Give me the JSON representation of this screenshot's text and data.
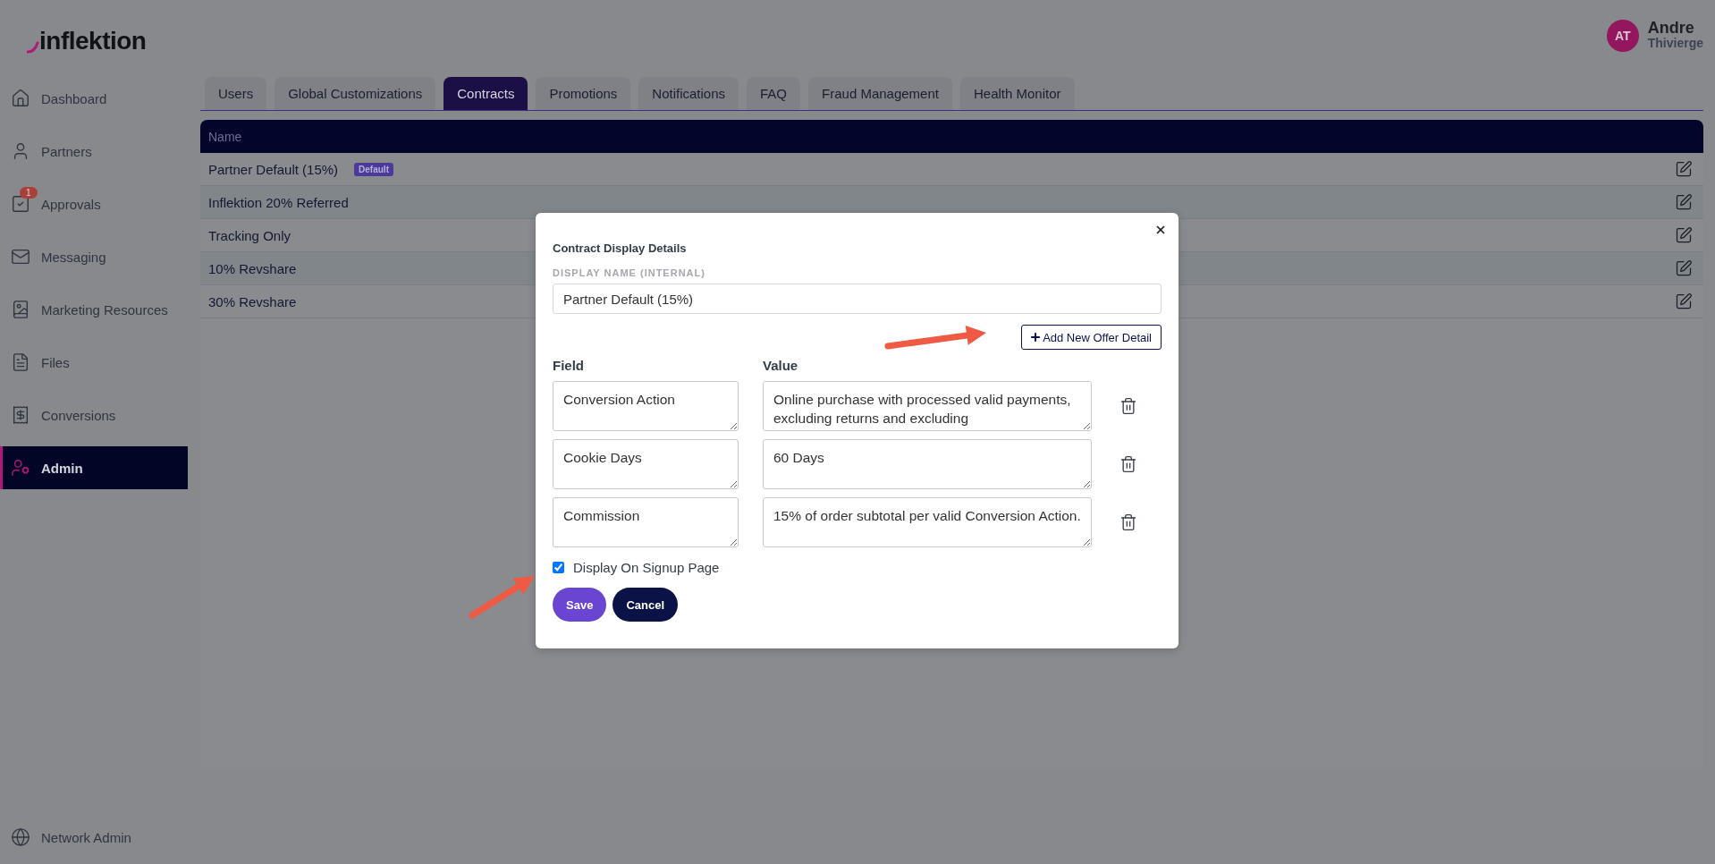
{
  "logo": {
    "text": "inflektion"
  },
  "user": {
    "initials": "AT",
    "first_name": "Andre",
    "last_name": "Thivierge"
  },
  "sidebar": {
    "items": [
      {
        "label": "Dashboard",
        "selected": false
      },
      {
        "label": "Partners",
        "selected": false
      },
      {
        "label": "Approvals",
        "selected": false,
        "badge": "1"
      },
      {
        "label": "Messaging",
        "selected": false
      },
      {
        "label": "Marketing Resources",
        "selected": false
      },
      {
        "label": "Files",
        "selected": false
      },
      {
        "label": "Conversions",
        "selected": false
      },
      {
        "label": "Admin",
        "selected": true
      }
    ],
    "footer": {
      "label": "Network Admin"
    }
  },
  "tabs": [
    {
      "label": "Users",
      "selected": false
    },
    {
      "label": "Global Customizations",
      "selected": false
    },
    {
      "label": "Contracts",
      "selected": true
    },
    {
      "label": "Promotions",
      "selected": false
    },
    {
      "label": "Notifications",
      "selected": false
    },
    {
      "label": "FAQ",
      "selected": false
    },
    {
      "label": "Fraud Management",
      "selected": false
    },
    {
      "label": "Health Monitor",
      "selected": false
    }
  ],
  "table": {
    "columns": [
      "Name"
    ],
    "rows": [
      {
        "name": "Partner Default (15%)",
        "badge": "Default"
      },
      {
        "name": "Inflektion 20% Referred"
      },
      {
        "name": "Tracking Only"
      },
      {
        "name": "10% Revshare"
      },
      {
        "name": "30% Revshare"
      }
    ]
  },
  "modal": {
    "title": "Contract Display Details",
    "display_name_label": "DISPLAY NAME (INTERNAL)",
    "display_name_value": "Partner Default (15%)",
    "add_button": "Add New Offer Detail",
    "field_header": "Field",
    "value_header": "Value",
    "details": [
      {
        "field": "Conversion Action",
        "value": "Online purchase with processed valid payments, excluding returns and excluding"
      },
      {
        "field": "Cookie Days",
        "value": "60 Days"
      },
      {
        "field": "Commission",
        "value": "15% of order subtotal per valid Conversion Action."
      }
    ],
    "checkbox": {
      "label": "Display On Signup Page",
      "checked": true
    },
    "save_button": "Save",
    "cancel_button": "Cancel"
  }
}
